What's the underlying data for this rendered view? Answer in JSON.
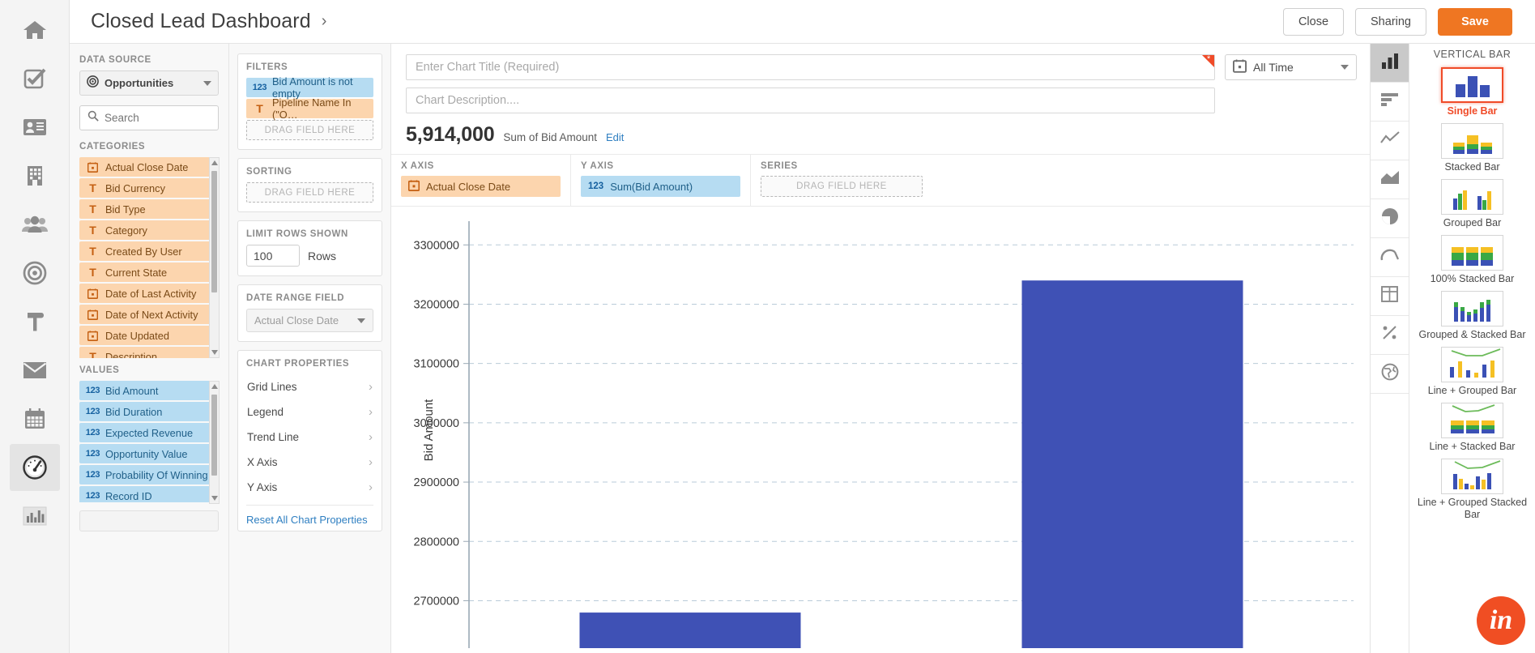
{
  "app": {
    "rail_icons": [
      {
        "name": "home-icon"
      },
      {
        "name": "tasks-checkbox-icon"
      },
      {
        "name": "contact-card-icon"
      },
      {
        "name": "company-building-icon"
      },
      {
        "name": "people-group-icon"
      },
      {
        "name": "target-opportunities-icon"
      },
      {
        "name": "hammer-projects-icon"
      },
      {
        "name": "email-envelope-icon"
      },
      {
        "name": "calendar-icon"
      },
      {
        "name": "dashboard-gauge-icon"
      },
      {
        "name": "reports-bar-icon"
      }
    ]
  },
  "header": {
    "title": "Closed Lead Dashboard",
    "chevron": "›",
    "close_label": "Close",
    "sharing_label": "Sharing",
    "save_label": "Save",
    "accent": "#ef7622"
  },
  "fields": {
    "data_source_label": "DATA SOURCE",
    "data_source_value": "Opportunities",
    "search_placeholder": "Search",
    "search_value": "",
    "categories_label": "CATEGORIES",
    "categories": [
      {
        "icon": "date-icon",
        "label": "Actual Close Date"
      },
      {
        "icon": "text-icon",
        "label": "Bid Currency"
      },
      {
        "icon": "text-icon",
        "label": "Bid Type"
      },
      {
        "icon": "text-icon",
        "label": "Category"
      },
      {
        "icon": "text-icon",
        "label": "Created By User"
      },
      {
        "icon": "text-icon",
        "label": "Current State"
      },
      {
        "icon": "date-icon",
        "label": "Date of Last Activity"
      },
      {
        "icon": "date-icon",
        "label": "Date of Next Activity"
      },
      {
        "icon": "date-icon",
        "label": "Date Updated"
      },
      {
        "icon": "text-icon",
        "label": "Description"
      }
    ],
    "values_label": "VALUES",
    "values": [
      {
        "icon": "number-icon",
        "label": "Bid Amount"
      },
      {
        "icon": "number-icon",
        "label": "Bid Duration"
      },
      {
        "icon": "number-icon",
        "label": "Expected Revenue"
      },
      {
        "icon": "number-icon",
        "label": "Opportunity Value"
      },
      {
        "icon": "number-icon",
        "label": "Probability Of Winning"
      },
      {
        "icon": "number-icon",
        "label": "Record ID"
      }
    ]
  },
  "filters_pane": {
    "filters_label": "FILTERS",
    "filters": [
      {
        "icon": "number-icon",
        "label": "Bid Amount is not empty",
        "type": "val"
      },
      {
        "icon": "text-icon",
        "label": "Pipeline Name In (\"O…",
        "type": "cat"
      }
    ],
    "drag_field_here": "DRAG FIELD HERE",
    "sorting_label": "SORTING",
    "limit_label": "LIMIT ROWS SHOWN",
    "limit_value": "100",
    "rows_label": "Rows",
    "date_range_label": "DATE RANGE FIELD",
    "date_range_value": "Actual Close Date",
    "chart_properties_label": "CHART PROPERTIES",
    "properties": [
      {
        "label": "Grid Lines"
      },
      {
        "label": "Legend"
      },
      {
        "label": "Trend Line"
      },
      {
        "label": "X Axis"
      },
      {
        "label": "Y Axis"
      }
    ],
    "reset_label": "Reset All Chart Properties"
  },
  "chart_head": {
    "title_placeholder": "Enter Chart Title (Required)",
    "title_value": "",
    "description_placeholder": "Chart Description....",
    "description_value": "",
    "date_filter_label": "All Time",
    "summary_value": "5,914,000",
    "summary_label": "Sum of Bid Amount",
    "summary_edit": "Edit",
    "x_axis_label": "X AXIS",
    "x_axis_field": "Actual Close Date",
    "y_axis_label": "Y AXIS",
    "y_axis_field": "Sum(Bid Amount)",
    "series_label": "SERIES",
    "series_placeholder": "DRAG FIELD HERE"
  },
  "chart_data": {
    "type": "bar",
    "title": "",
    "xlabel": "",
    "ylabel": "Bid Amount",
    "categories": [
      "",
      ""
    ],
    "values": [
      2680000,
      3240000
    ],
    "ylim": [
      2620000,
      3340000
    ],
    "yticks": [
      2700000,
      2800000,
      2900000,
      3000000,
      3100000,
      3200000,
      3300000
    ],
    "ytick_labels": [
      "2700000",
      "2800000",
      "2900000",
      "3000000",
      "3100000",
      "3200000",
      "3300000"
    ],
    "grid": true,
    "legend": false,
    "bar_color": "#3f51b5",
    "grid_color": "#b9cbd8"
  },
  "type_panel": {
    "rail_icons": [
      {
        "name": "vertical-bar-icon",
        "active": true
      },
      {
        "name": "horizontal-bar-icon",
        "active": false
      },
      {
        "name": "line-chart-icon",
        "active": false
      },
      {
        "name": "area-chart-icon",
        "active": false
      },
      {
        "name": "pie-chart-icon",
        "active": false
      },
      {
        "name": "gauge-chart-icon",
        "active": false
      },
      {
        "name": "table-icon",
        "active": false
      },
      {
        "name": "scatter-percent-icon",
        "active": false
      },
      {
        "name": "globe-map-icon",
        "active": false
      }
    ],
    "group_title": "VERTICAL BAR",
    "items": [
      {
        "label": "Single Bar",
        "selected": true
      },
      {
        "label": "Stacked Bar",
        "selected": false
      },
      {
        "label": "Grouped Bar",
        "selected": false
      },
      {
        "label": "100% Stacked Bar",
        "selected": false
      },
      {
        "label": "Grouped & Stacked Bar",
        "selected": false
      },
      {
        "label": "Line + Grouped Bar",
        "selected": false
      },
      {
        "label": "Line + Stacked Bar",
        "selected": false
      },
      {
        "label": "Line + Grouped Stacked Bar",
        "selected": false
      }
    ]
  },
  "floating": {
    "badge_text": "in"
  }
}
